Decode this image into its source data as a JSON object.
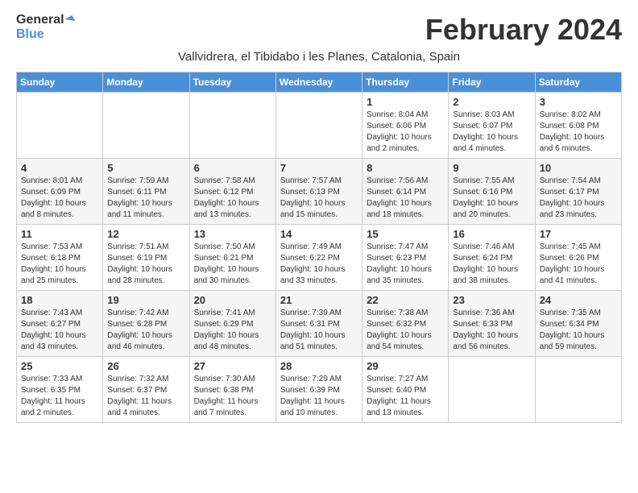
{
  "header": {
    "logo_line1": "General",
    "logo_line2": "Blue",
    "title": "February 2024",
    "subtitle": "Vallvidrera, el Tibidabo i les Planes, Catalonia, Spain"
  },
  "days_of_week": [
    "Sunday",
    "Monday",
    "Tuesday",
    "Wednesday",
    "Thursday",
    "Friday",
    "Saturday"
  ],
  "weeks": [
    [
      {
        "num": "",
        "info": ""
      },
      {
        "num": "",
        "info": ""
      },
      {
        "num": "",
        "info": ""
      },
      {
        "num": "",
        "info": ""
      },
      {
        "num": "1",
        "info": "Sunrise: 8:04 AM\nSunset: 6:06 PM\nDaylight: 10 hours and 2 minutes."
      },
      {
        "num": "2",
        "info": "Sunrise: 8:03 AM\nSunset: 6:07 PM\nDaylight: 10 hours and 4 minutes."
      },
      {
        "num": "3",
        "info": "Sunrise: 8:02 AM\nSunset: 6:08 PM\nDaylight: 10 hours and 6 minutes."
      }
    ],
    [
      {
        "num": "4",
        "info": "Sunrise: 8:01 AM\nSunset: 6:09 PM\nDaylight: 10 hours and 8 minutes."
      },
      {
        "num": "5",
        "info": "Sunrise: 7:59 AM\nSunset: 6:11 PM\nDaylight: 10 hours and 11 minutes."
      },
      {
        "num": "6",
        "info": "Sunrise: 7:58 AM\nSunset: 6:12 PM\nDaylight: 10 hours and 13 minutes."
      },
      {
        "num": "7",
        "info": "Sunrise: 7:57 AM\nSunset: 6:13 PM\nDaylight: 10 hours and 15 minutes."
      },
      {
        "num": "8",
        "info": "Sunrise: 7:56 AM\nSunset: 6:14 PM\nDaylight: 10 hours and 18 minutes."
      },
      {
        "num": "9",
        "info": "Sunrise: 7:55 AM\nSunset: 6:16 PM\nDaylight: 10 hours and 20 minutes."
      },
      {
        "num": "10",
        "info": "Sunrise: 7:54 AM\nSunset: 6:17 PM\nDaylight: 10 hours and 23 minutes."
      }
    ],
    [
      {
        "num": "11",
        "info": "Sunrise: 7:53 AM\nSunset: 6:18 PM\nDaylight: 10 hours and 25 minutes."
      },
      {
        "num": "12",
        "info": "Sunrise: 7:51 AM\nSunset: 6:19 PM\nDaylight: 10 hours and 28 minutes."
      },
      {
        "num": "13",
        "info": "Sunrise: 7:50 AM\nSunset: 6:21 PM\nDaylight: 10 hours and 30 minutes."
      },
      {
        "num": "14",
        "info": "Sunrise: 7:49 AM\nSunset: 6:22 PM\nDaylight: 10 hours and 33 minutes."
      },
      {
        "num": "15",
        "info": "Sunrise: 7:47 AM\nSunset: 6:23 PM\nDaylight: 10 hours and 35 minutes."
      },
      {
        "num": "16",
        "info": "Sunrise: 7:46 AM\nSunset: 6:24 PM\nDaylight: 10 hours and 38 minutes."
      },
      {
        "num": "17",
        "info": "Sunrise: 7:45 AM\nSunset: 6:26 PM\nDaylight: 10 hours and 41 minutes."
      }
    ],
    [
      {
        "num": "18",
        "info": "Sunrise: 7:43 AM\nSunset: 6:27 PM\nDaylight: 10 hours and 43 minutes."
      },
      {
        "num": "19",
        "info": "Sunrise: 7:42 AM\nSunset: 6:28 PM\nDaylight: 10 hours and 46 minutes."
      },
      {
        "num": "20",
        "info": "Sunrise: 7:41 AM\nSunset: 6:29 PM\nDaylight: 10 hours and 48 minutes."
      },
      {
        "num": "21",
        "info": "Sunrise: 7:39 AM\nSunset: 6:31 PM\nDaylight: 10 hours and 51 minutes."
      },
      {
        "num": "22",
        "info": "Sunrise: 7:38 AM\nSunset: 6:32 PM\nDaylight: 10 hours and 54 minutes."
      },
      {
        "num": "23",
        "info": "Sunrise: 7:36 AM\nSunset: 6:33 PM\nDaylight: 10 hours and 56 minutes."
      },
      {
        "num": "24",
        "info": "Sunrise: 7:35 AM\nSunset: 6:34 PM\nDaylight: 10 hours and 59 minutes."
      }
    ],
    [
      {
        "num": "25",
        "info": "Sunrise: 7:33 AM\nSunset: 6:35 PM\nDaylight: 11 hours and 2 minutes."
      },
      {
        "num": "26",
        "info": "Sunrise: 7:32 AM\nSunset: 6:37 PM\nDaylight: 11 hours and 4 minutes."
      },
      {
        "num": "27",
        "info": "Sunrise: 7:30 AM\nSunset: 6:38 PM\nDaylight: 11 hours and 7 minutes."
      },
      {
        "num": "28",
        "info": "Sunrise: 7:29 AM\nSunset: 6:39 PM\nDaylight: 11 hours and 10 minutes."
      },
      {
        "num": "29",
        "info": "Sunrise: 7:27 AM\nSunset: 6:40 PM\nDaylight: 11 hours and 13 minutes."
      },
      {
        "num": "",
        "info": ""
      },
      {
        "num": "",
        "info": ""
      }
    ]
  ]
}
